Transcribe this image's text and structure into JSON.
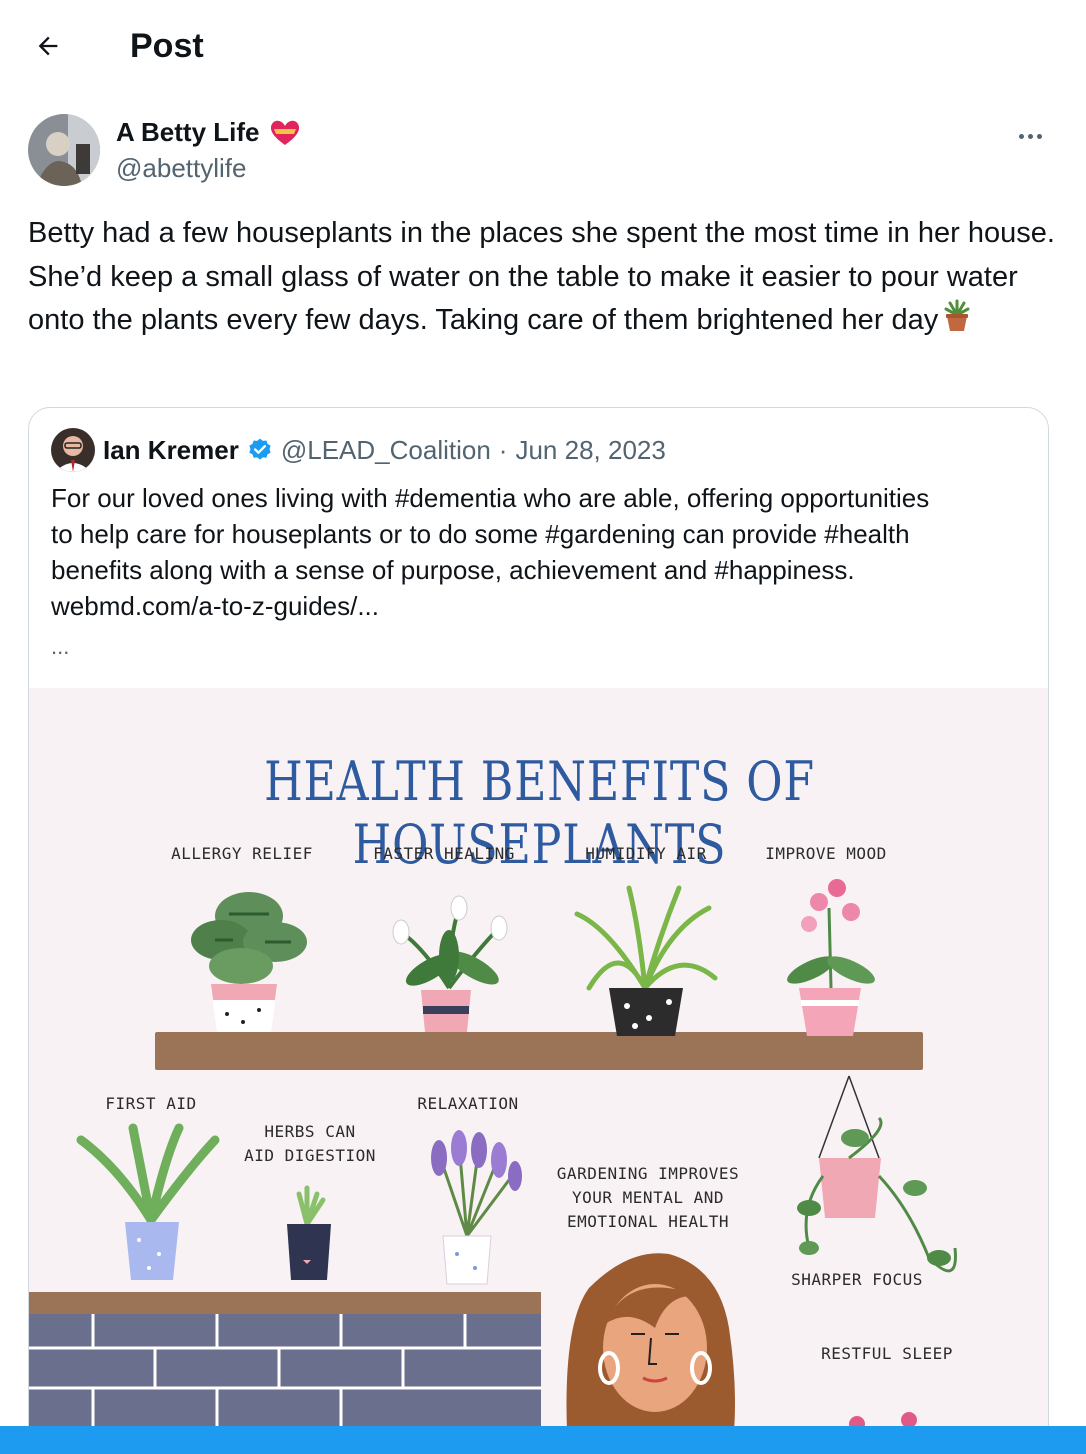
{
  "header": {
    "title": "Post",
    "back_icon": "arrow-left-icon"
  },
  "post": {
    "author_name": "A Betty Life",
    "author_handle": "@abettylife",
    "text": "Betty had a few houseplants in the places she spent the most time in her house. She’d keep a small glass of water  on the table to make it easier to pour water onto the plants every few days. Taking care of them brightened her day",
    "emoji": "potted-plant-icon",
    "more_icon": "more-horizontal-icon"
  },
  "quote": {
    "author_name": "Ian Kremer",
    "verified": true,
    "handle": "@LEAD_Coalition",
    "separator": "·",
    "date": "Jun 28, 2023",
    "text_lines": [
      "For our loved ones living with #dementia who are able, offering opportunities",
      "to help care for houseplants or to do some #gardening can provide #health",
      "benefits along with a sense of purpose, achievement and #happiness.",
      "webmd.com/a-to-z-guides/..."
    ],
    "ellipsis": "..."
  },
  "infographic": {
    "title": "HEALTH BENEFITS OF HOUSEPLANTS",
    "labels": {
      "allergy": "ALLERGY RELIEF",
      "healing": "FASTER HEALING",
      "humidify": "HUMIDIFY AIR",
      "mood": "IMPROVE MOOD",
      "firstaid": "FIRST AID",
      "herbs_1": "HERBS CAN",
      "herbs_2": "AID DIGESTION",
      "relax": "RELAXATION",
      "garden_1": "GARDENING IMPROVES",
      "garden_2": "YOUR MENTAL AND",
      "garden_3": "EMOTIONAL HEALTH",
      "focus": "SHARPER FOCUS",
      "sleep": "RESTFUL SLEEP"
    },
    "colors": {
      "title": "#2e5aa0",
      "shelf": "#9b7458",
      "wall": "#6b6f8e",
      "background": "#f9f2f5"
    }
  },
  "colors": {
    "accent": "#1d9bf0",
    "secondary_text": "#536471",
    "border": "#cfd9de"
  }
}
